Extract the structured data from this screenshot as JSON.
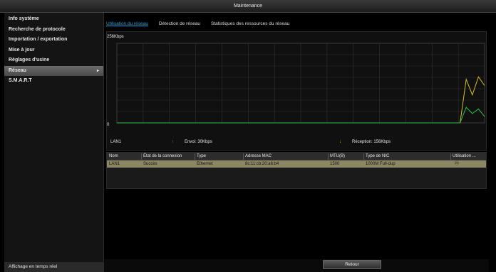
{
  "window": {
    "title": "Maintenance"
  },
  "sidebar": {
    "items": [
      {
        "label": "Info système"
      },
      {
        "label": "Recherche de protocole"
      },
      {
        "label": "Importation / exportation"
      },
      {
        "label": "Mise à jour"
      },
      {
        "label": "Réglages d'usine"
      },
      {
        "label": "Réseau",
        "arrow": "▸"
      },
      {
        "label": "S.M.A.R.T"
      }
    ],
    "footer": "Affichage en temps réel"
  },
  "tabs": [
    {
      "label": "Utilisation du réseau"
    },
    {
      "label": "Détection de réseau"
    },
    {
      "label": "Statistiques des ressources du réseau"
    }
  ],
  "chart_data": {
    "type": "line",
    "ylabel": "256Kbps",
    "ymin_label": "0",
    "ylim": [
      0,
      256
    ],
    "x": [
      0,
      1,
      2,
      3,
      4,
      5,
      6,
      7,
      8,
      9,
      10,
      11,
      12,
      13,
      14,
      15,
      16,
      17,
      18,
      19,
      20,
      21,
      22,
      23,
      24,
      25,
      26,
      27,
      28,
      29,
      30,
      31,
      32,
      33,
      34,
      35,
      36,
      37,
      38,
      39,
      40,
      41,
      42,
      43,
      44,
      45,
      46,
      47,
      48,
      49,
      50,
      51,
      52,
      53,
      54,
      55,
      56,
      57,
      58,
      59,
      60
    ],
    "series": [
      {
        "name": "Envoi",
        "color": "#2ec24a",
        "values": [
          0,
          0,
          0,
          0,
          0,
          0,
          0,
          0,
          0,
          0,
          0,
          0,
          0,
          0,
          0,
          0,
          0,
          0,
          0,
          0,
          0,
          0,
          0,
          0,
          0,
          0,
          0,
          0,
          0,
          0,
          0,
          0,
          0,
          0,
          0,
          0,
          0,
          0,
          0,
          0,
          0,
          0,
          0,
          0,
          0,
          0,
          0,
          0,
          0,
          0,
          0,
          0,
          0,
          0,
          0,
          0,
          0,
          50,
          30,
          45,
          20
        ]
      },
      {
        "name": "Réception",
        "color": "#d4c21a",
        "values": [
          0,
          0,
          0,
          0,
          0,
          0,
          0,
          0,
          0,
          0,
          0,
          0,
          0,
          0,
          0,
          0,
          0,
          0,
          0,
          0,
          0,
          0,
          0,
          0,
          0,
          0,
          0,
          0,
          0,
          0,
          0,
          0,
          0,
          0,
          0,
          0,
          0,
          0,
          0,
          0,
          0,
          0,
          0,
          0,
          0,
          0,
          0,
          0,
          0,
          0,
          0,
          0,
          0,
          0,
          0,
          0,
          0,
          140,
          90,
          148,
          120
        ]
      }
    ]
  },
  "legend": {
    "interface": "LAN1",
    "send_label": "Envoi: 30Kbps",
    "receive_label": "Réception: 156Kbps",
    "send_arrow": "↑",
    "receive_arrow": "↓",
    "send_color": "#2ec24a",
    "receive_color": "#e0c21a"
  },
  "table": {
    "headers": [
      "Nom",
      "État de la connexion",
      "Type",
      "Adresse MAC",
      "MTU(B)",
      "Type de NIC",
      "Utilisation ..."
    ],
    "rows": [
      [
        "LAN1",
        "Succès",
        "Ethernet",
        "8c:11:cb:20:a6:b4",
        "1500",
        "1000M Full-dup",
        "ⓜ"
      ]
    ]
  },
  "buttons": {
    "back": "Retour"
  }
}
